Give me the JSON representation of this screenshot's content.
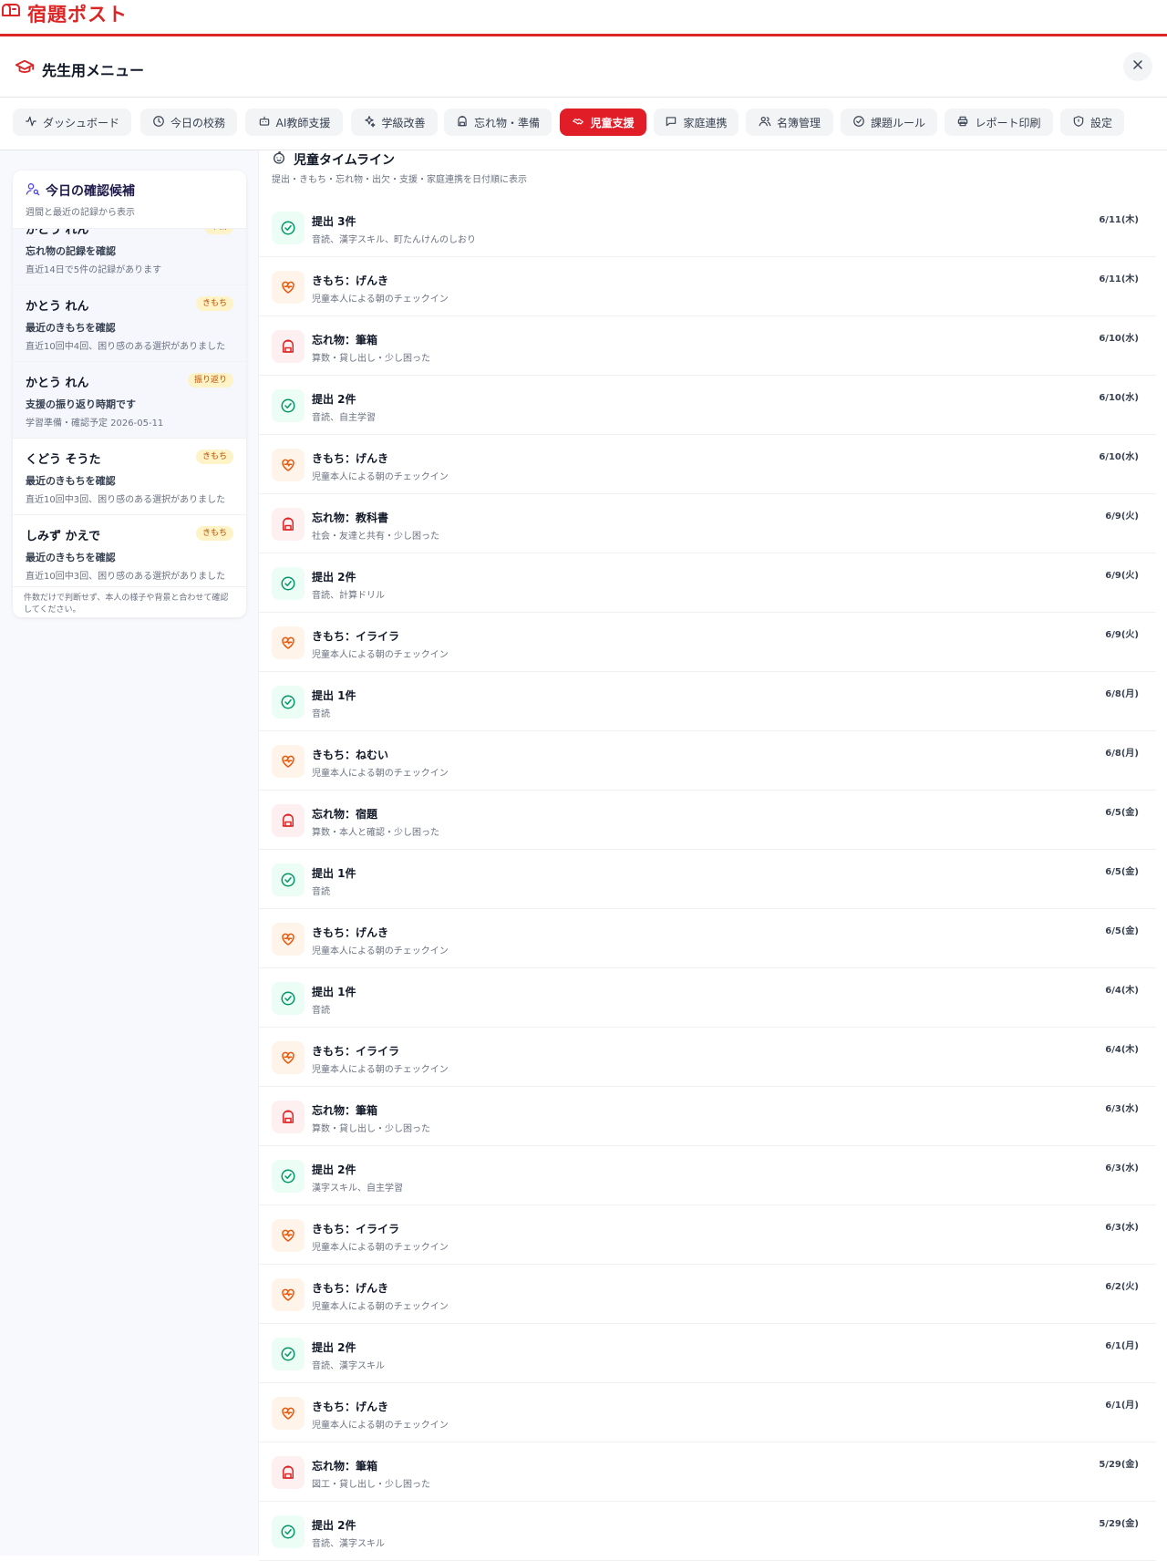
{
  "app": {
    "title": "宿題ポスト",
    "brand_color": "#dc2626"
  },
  "menu": {
    "title": "先生用メニュー",
    "close_icon": "close-icon"
  },
  "tabs": [
    {
      "label": "ダッシュボード",
      "icon": "activity-icon",
      "active": false
    },
    {
      "label": "今日の校務",
      "icon": "clock-icon",
      "active": false
    },
    {
      "label": "AI教師支援",
      "icon": "bot-icon",
      "active": false
    },
    {
      "label": "学級改善",
      "icon": "sparkles-icon",
      "active": false
    },
    {
      "label": "忘れ物・準備",
      "icon": "backpack-icon",
      "active": false
    },
    {
      "label": "児童支援",
      "icon": "handshake-icon",
      "active": true
    },
    {
      "label": "家庭連携",
      "icon": "message-icon",
      "active": false
    },
    {
      "label": "名簿管理",
      "icon": "users-icon",
      "active": false
    },
    {
      "label": "課題ルール",
      "icon": "check-circle-icon",
      "active": false
    },
    {
      "label": "レポート印刷",
      "icon": "printer-icon",
      "active": false
    },
    {
      "label": "設定",
      "icon": "shield-icon",
      "active": false
    }
  ],
  "sidebar": {
    "title": "今日の確認候補",
    "subtitle": "週間と最近の記録から表示",
    "items": [
      {
        "name": "かとう れん",
        "badge": "準備",
        "title": "忘れ物の記録を確認",
        "desc": "直近14日で5件の記録があります",
        "highlight": true
      },
      {
        "name": "かとう れん",
        "badge": "きもち",
        "title": "最近のきもちを確認",
        "desc": "直近10回中4回、困り感のある選択がありました",
        "highlight": true
      },
      {
        "name": "かとう れん",
        "badge": "振り返り",
        "title": "支援の振り返り時期です",
        "desc": "学習準備・確認予定 2026-05-11",
        "highlight": true
      },
      {
        "name": "くどう そうた",
        "badge": "きもち",
        "title": "最近のきもちを確認",
        "desc": "直近10回中3回、困り感のある選択がありました",
        "highlight": false
      },
      {
        "name": "しみず かえで",
        "badge": "きもち",
        "title": "最近のきもちを確認",
        "desc": "直近10回中3回、困り感のある選択がありました",
        "highlight": false
      }
    ],
    "footer": "件数だけで判断せず、本人の様子や背景と合わせて確認してください。"
  },
  "timeline": {
    "title": "児童タイムライン",
    "subtitle": "提出・きもち・忘れ物・出欠・支援・家庭連携を日付順に表示",
    "items": [
      {
        "type": "submit",
        "label": "提出 3件",
        "detail": "音読、漢字スキル、町たんけんのしおり",
        "date": "6/11(木)"
      },
      {
        "type": "mood",
        "label": "きもち：げんき",
        "detail": "児童本人による朝のチェックイン",
        "date": "6/11(木)"
      },
      {
        "type": "forgot",
        "label": "忘れ物：筆箱",
        "detail": "算数・貸し出し・少し困った",
        "date": "6/10(水)"
      },
      {
        "type": "submit",
        "label": "提出 2件",
        "detail": "音読、自主学習",
        "date": "6/10(水)"
      },
      {
        "type": "mood",
        "label": "きもち：げんき",
        "detail": "児童本人による朝のチェックイン",
        "date": "6/10(水)"
      },
      {
        "type": "forgot",
        "label": "忘れ物：教科書",
        "detail": "社会・友達と共有・少し困った",
        "date": "6/9(火)"
      },
      {
        "type": "submit",
        "label": "提出 2件",
        "detail": "音読、計算ドリル",
        "date": "6/9(火)"
      },
      {
        "type": "mood",
        "label": "きもち：イライラ",
        "detail": "児童本人による朝のチェックイン",
        "date": "6/9(火)"
      },
      {
        "type": "submit",
        "label": "提出 1件",
        "detail": "音読",
        "date": "6/8(月)"
      },
      {
        "type": "mood",
        "label": "きもち：ねむい",
        "detail": "児童本人による朝のチェックイン",
        "date": "6/8(月)"
      },
      {
        "type": "forgot",
        "label": "忘れ物：宿題",
        "detail": "算数・本人と確認・少し困った",
        "date": "6/5(金)"
      },
      {
        "type": "submit",
        "label": "提出 1件",
        "detail": "音読",
        "date": "6/5(金)"
      },
      {
        "type": "mood",
        "label": "きもち：げんき",
        "detail": "児童本人による朝のチェックイン",
        "date": "6/5(金)"
      },
      {
        "type": "submit",
        "label": "提出 1件",
        "detail": "音読",
        "date": "6/4(木)"
      },
      {
        "type": "mood",
        "label": "きもち：イライラ",
        "detail": "児童本人による朝のチェックイン",
        "date": "6/4(木)"
      },
      {
        "type": "forgot",
        "label": "忘れ物：筆箱",
        "detail": "算数・貸し出し・少し困った",
        "date": "6/3(水)"
      },
      {
        "type": "submit",
        "label": "提出 2件",
        "detail": "漢字スキル、自主学習",
        "date": "6/3(水)"
      },
      {
        "type": "mood",
        "label": "きもち：イライラ",
        "detail": "児童本人による朝のチェックイン",
        "date": "6/3(水)"
      },
      {
        "type": "mood",
        "label": "きもち：げんき",
        "detail": "児童本人による朝のチェックイン",
        "date": "6/2(火)"
      },
      {
        "type": "submit",
        "label": "提出 2件",
        "detail": "音読、漢字スキル",
        "date": "6/1(月)"
      },
      {
        "type": "mood",
        "label": "きもち：げんき",
        "detail": "児童本人による朝のチェックイン",
        "date": "6/1(月)"
      },
      {
        "type": "forgot",
        "label": "忘れ物：筆箱",
        "detail": "図工・貸し出し・少し困った",
        "date": "5/29(金)"
      },
      {
        "type": "submit",
        "label": "提出 2件",
        "detail": "音読、漢字スキル",
        "date": "5/29(金)"
      }
    ]
  }
}
